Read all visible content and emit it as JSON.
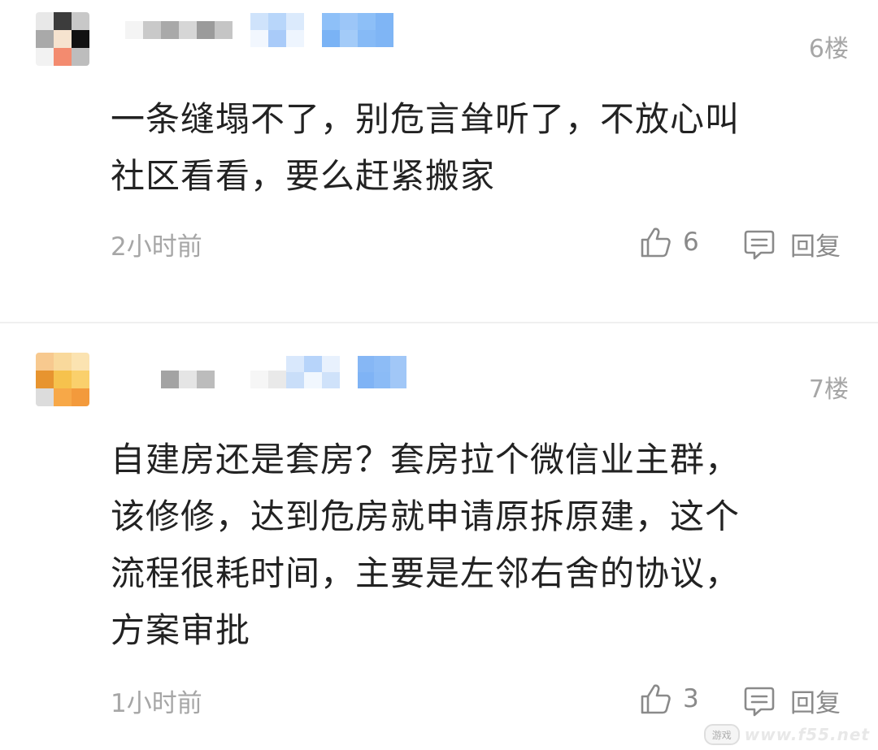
{
  "comments": [
    {
      "floor": "6楼",
      "content_lines": [
        "一条缝塌不了，别危言耸听了，不放心叫",
        "社区看看，要么赶紧搬家"
      ],
      "time": "2小时前",
      "likes": "6",
      "reply_label": "回复",
      "avatar_colors": [
        "#e8e8e8",
        "#3c3c3c",
        "#c8c8c8",
        "#a9a9a9",
        "#f6e3cf",
        "#111111",
        "#f2f2f2",
        "#f38b6f",
        "#bdbdbd"
      ],
      "name_colors": [
        "#f4f4f4",
        "#c9c9c9",
        "#a9a9a9",
        "#d6d6d6",
        "#9b9b9b",
        "#c5c5c5"
      ],
      "tag_colors": [
        "#cfe3fb",
        "#b8d6fa",
        "#f2f7fe",
        "#8ec0f8",
        "#9cc6f8",
        "#7fb5f5"
      ]
    },
    {
      "floor": "7楼",
      "content_lines": [
        "自建房还是套房？套房拉个微信业主群，",
        "该修修，达到危房就申请原拆原建，这个",
        "流程很耗时间，主要是左邻右舍的协议，",
        "方案审批"
      ],
      "time": "1小时前",
      "likes": "3",
      "reply_label": "回复",
      "avatar_colors": [
        "#f7c98f",
        "#f9d99c",
        "#fbe3b1",
        "#e7942f",
        "#f6c24d",
        "#fad06c",
        "#dcdcdc",
        "#f7a848",
        "#f39a3c"
      ],
      "name_colors": [
        "#a3a3a3",
        "#e5e5e5",
        "#bcbcbc",
        "#f6f6f6",
        "#e9e9e9"
      ],
      "tag_colors": [
        "#b7d4fa",
        "#e8f1fd",
        "#c9def9",
        "#86b7f5",
        "#a1c7f7"
      ]
    }
  ],
  "watermark": {
    "badge": "游戏",
    "text": "www.f55.net"
  },
  "icons": {
    "like": "thumbs-up-icon",
    "reply": "comment-icon"
  }
}
